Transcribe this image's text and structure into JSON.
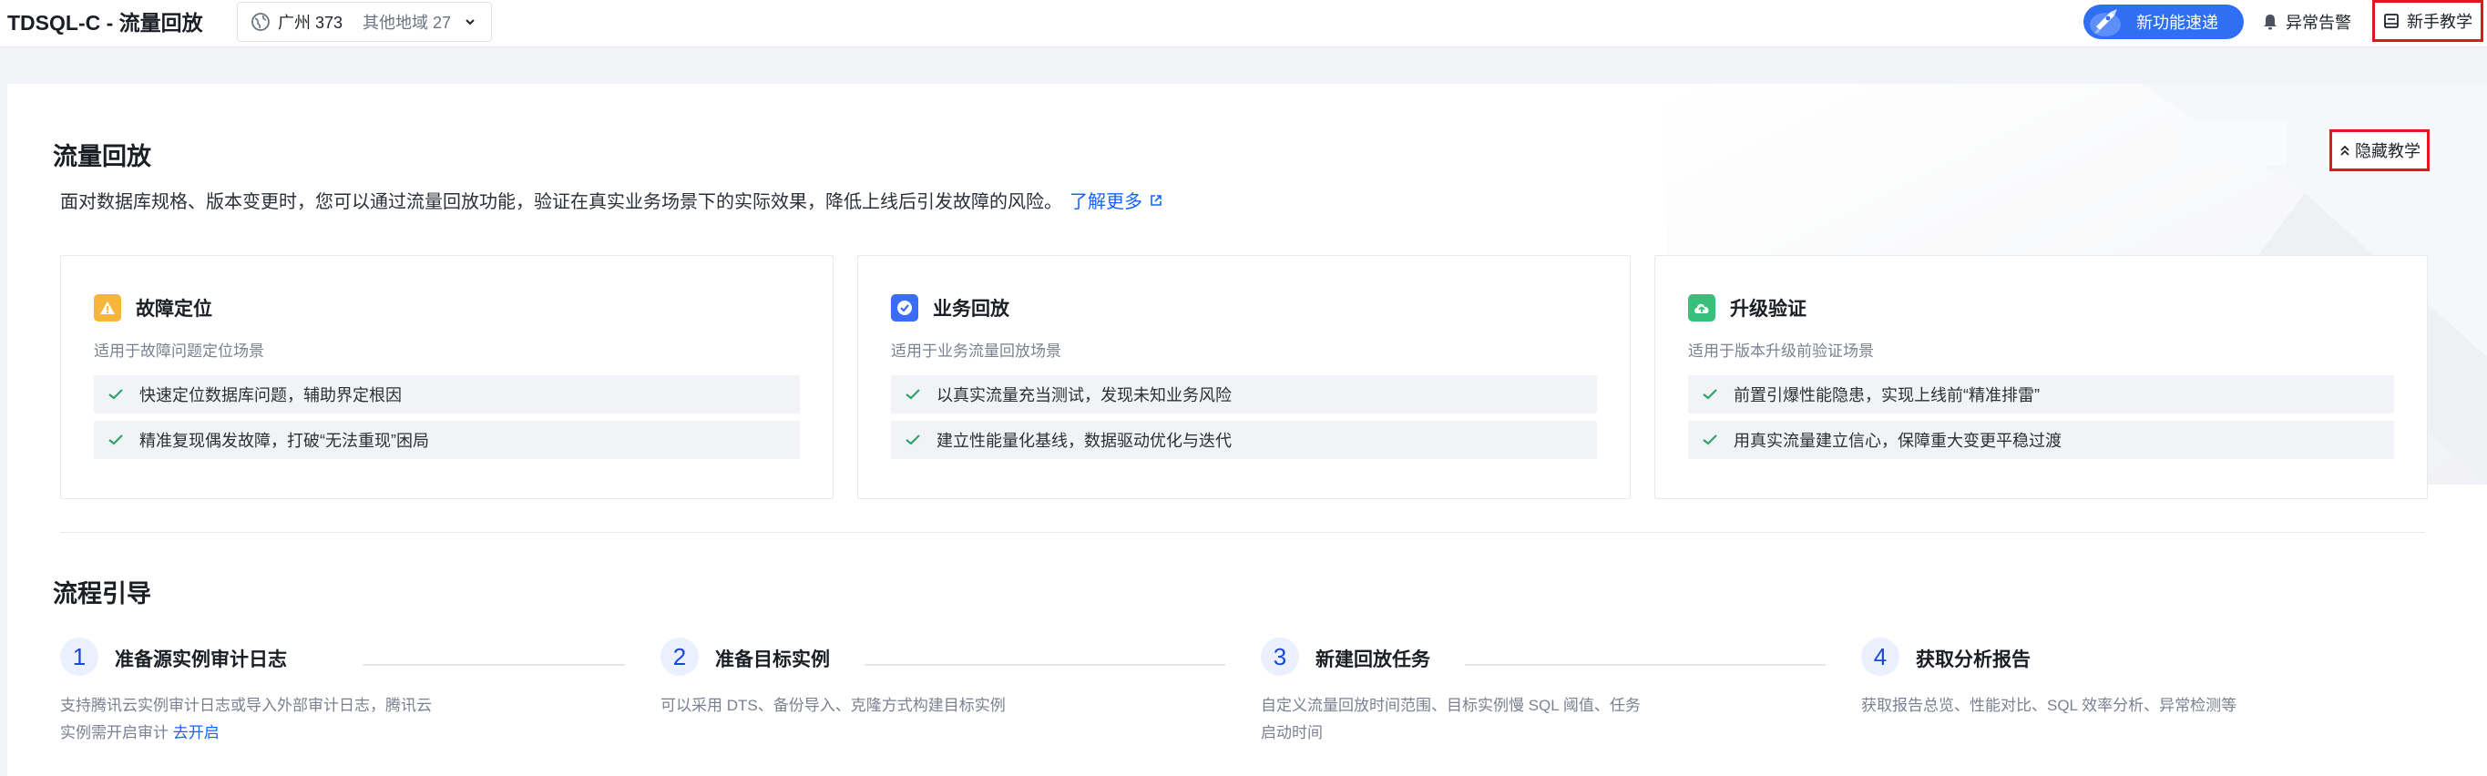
{
  "header": {
    "app_title": "TDSQL-C - 流量回放",
    "region_main": "广州 373",
    "region_other": "其他地域 27",
    "new_features": "新功能速递",
    "alarm": "异常告警",
    "tutorial": "新手教学"
  },
  "intro": {
    "title": "流量回放",
    "description": "面对数据库规格、版本变更时，您可以通过流量回放功能，验证在真实业务场景下的实际效果，降低上线后引发故障的风险。",
    "learn_more": "了解更多",
    "hide_tutorial": "隐藏教学"
  },
  "cards": [
    {
      "title": "故障定位",
      "subtitle": "适用于故障问题定位场景",
      "items": [
        "快速定位数据库问题，辅助界定根因",
        "精准复现偶发故障，打破“无法重现”困局"
      ],
      "icon": "warning-icon",
      "color": "#f5b63b"
    },
    {
      "title": "业务回放",
      "subtitle": "适用于业务流量回放场景",
      "items": [
        "以真实流量充当测试，发现未知业务风险",
        "建立性能量化基线，数据驱动优化与迭代"
      ],
      "icon": "verified-icon",
      "color": "#3a6cf6"
    },
    {
      "title": "升级验证",
      "subtitle": "适用于版本升级前验证场景",
      "items": [
        "前置引爆性能隐患，实现上线前“精准排雷”",
        "用真实流量建立信心，保障重大变更平稳过渡"
      ],
      "icon": "cloud-upload-icon",
      "color": "#37c07a"
    }
  ],
  "flow": {
    "title": "流程引导",
    "steps": [
      {
        "num": "1",
        "title": "准备源实例审计日志",
        "desc": "支持腾讯云实例审计日志或导入外部审计日志，腾讯云实例需开启审计",
        "link": "去开启"
      },
      {
        "num": "2",
        "title": "准备目标实例",
        "desc": "可以采用 DTS、备份导入、克隆方式构建目标实例",
        "link": ""
      },
      {
        "num": "3",
        "title": "新建回放任务",
        "desc": "自定义流量回放时间范围、目标实例慢 SQL 阈值、任务启动时间",
        "link": ""
      },
      {
        "num": "4",
        "title": "获取分析报告",
        "desc": "获取报告总览、性能对比、SQL 效率分析、异常检测等",
        "link": ""
      }
    ]
  },
  "colors": {
    "accent": "#1664ff",
    "highlight_border": "#e2161f",
    "check": "#2ea36a"
  }
}
